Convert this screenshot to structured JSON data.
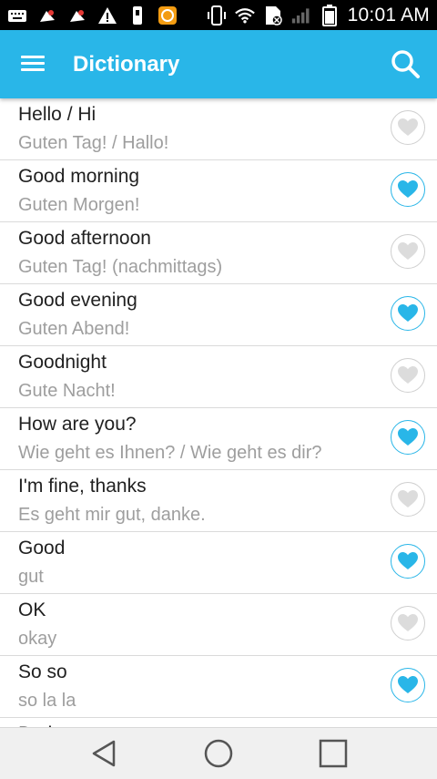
{
  "status_bar": {
    "time": "10:01 AM",
    "icons": [
      "keyboard-icon",
      "app-notification-icon",
      "app-notification-icon",
      "warning-icon",
      "usb-icon",
      "app-badge-icon",
      "phone-vibrate-icon",
      "wifi-icon",
      "no-sim-icon",
      "signal-icon",
      "battery-icon"
    ]
  },
  "app_bar": {
    "title": "Dictionary",
    "menu_icon": "menu-icon",
    "search_icon": "search-icon",
    "color": "#29b6e8"
  },
  "entries": [
    {
      "english": "Hello / Hi",
      "german": "Guten Tag! / Hallo!",
      "favorite": false
    },
    {
      "english": "Good morning",
      "german": "Guten Morgen!",
      "favorite": true
    },
    {
      "english": "Good afternoon",
      "german": "Guten Tag! (nachmittags)",
      "favorite": false
    },
    {
      "english": "Good evening",
      "german": "Guten Abend!",
      "favorite": true
    },
    {
      "english": "Goodnight",
      "german": "Gute Nacht!",
      "favorite": false
    },
    {
      "english": "How are you?",
      "german": "Wie geht es Ihnen? / Wie geht es dir?",
      "favorite": true
    },
    {
      "english": "I'm fine, thanks",
      "german": "Es geht mir gut, danke.",
      "favorite": false
    },
    {
      "english": "Good",
      "german": "gut",
      "favorite": true
    },
    {
      "english": "OK",
      "german": "okay",
      "favorite": false
    },
    {
      "english": "So so",
      "german": "so la la",
      "favorite": true
    },
    {
      "english": "Bad",
      "german": "",
      "favorite": false
    }
  ],
  "colors": {
    "accent": "#29b6e8",
    "heart_off": "#dcdcdc",
    "heart_on": "#29b6e8"
  },
  "nav_bar": {
    "icons": [
      "back-icon",
      "home-icon",
      "recents-icon"
    ]
  }
}
